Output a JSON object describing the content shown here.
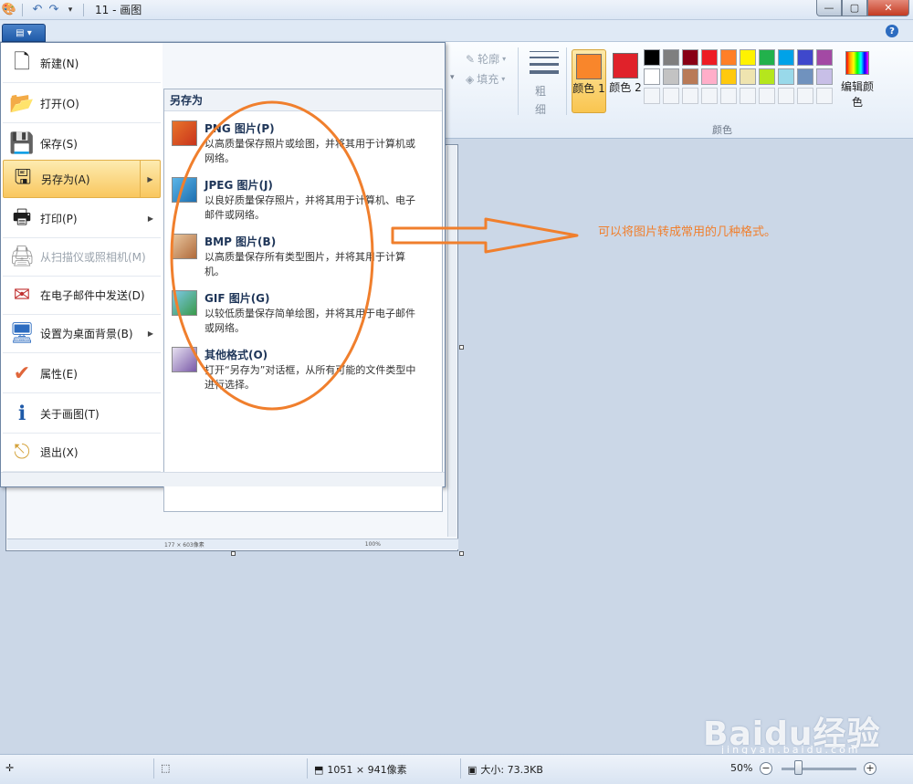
{
  "window": {
    "title": "11 - 画图",
    "controls": {
      "minimize": "—",
      "maximize": "▢",
      "close": "✕"
    }
  },
  "ribbon": {
    "help": "?",
    "outline_label": "轮廓",
    "fill_label": "填充",
    "thickness_label": "粗细",
    "color1_label": "颜色 1",
    "color2_label": "颜色 2",
    "edit_colors_label": "编辑颜色",
    "colors_group_label": "颜色",
    "color1": "#f9862b",
    "color2": "#e0222a",
    "palette": [
      "#000000",
      "#7f7f7f",
      "#880015",
      "#ed1c24",
      "#ff7f27",
      "#fff200",
      "#22b14c",
      "#00a2e8",
      "#3f48cc",
      "#a349a4",
      "#ffffff",
      "#c3c3c3",
      "#b97a57",
      "#ffaec9",
      "#ffc90e",
      "#efe4b0",
      "#b5e61d",
      "#99d9ea",
      "#7092be",
      "#c8bfe7"
    ]
  },
  "menu": {
    "items": [
      {
        "label": "新建(N)",
        "icon": "new-file-icon",
        "disabled": false,
        "submenu": false
      },
      {
        "label": "打开(O)",
        "icon": "open-folder-icon",
        "disabled": false,
        "submenu": false
      },
      {
        "label": "保存(S)",
        "icon": "save-disk-icon",
        "disabled": false,
        "submenu": false
      },
      {
        "label": "另存为(A)",
        "icon": "save-as-icon",
        "disabled": false,
        "submenu": true,
        "active": true
      },
      {
        "label": "打印(P)",
        "icon": "printer-icon",
        "disabled": false,
        "submenu": true
      },
      {
        "label": "从扫描仪或照相机(M)",
        "icon": "scanner-icon",
        "disabled": true,
        "submenu": false
      },
      {
        "label": "在电子邮件中发送(D)",
        "icon": "email-icon",
        "disabled": false,
        "submenu": false
      },
      {
        "label": "设置为桌面背景(B)",
        "icon": "desktop-background-icon",
        "disabled": false,
        "submenu": true
      },
      {
        "label": "属性(E)",
        "icon": "checkmark-icon",
        "disabled": false,
        "submenu": false
      },
      {
        "label": "关于画图(T)",
        "icon": "info-icon",
        "disabled": false,
        "submenu": false
      },
      {
        "label": "退出(X)",
        "icon": "exit-icon",
        "disabled": false,
        "submenu": false
      }
    ]
  },
  "save_as": {
    "header": "另存为",
    "items": [
      {
        "name": "PNG 图片(P)",
        "desc": "以高质量保存照片或绘图，并将其用于计算机或网络。",
        "icon": "png-image-icon"
      },
      {
        "name": "JPEG 图片(J)",
        "desc": "以良好质量保存照片，并将其用于计算机、电子邮件或网络。",
        "icon": "jpeg-image-icon"
      },
      {
        "name": "BMP 图片(B)",
        "desc": "以高质量保存所有类型图片，并将其用于计算机。",
        "icon": "bmp-image-icon"
      },
      {
        "name": "GIF 图片(G)",
        "desc": "以较低质量保存简单绘图，并将其用于电子邮件或网络。",
        "icon": "gif-image-icon"
      },
      {
        "name": "其他格式(O)",
        "desc": "打开“另存为”对话框，从所有可能的文件类型中进行选择。",
        "icon": "other-formats-icon"
      }
    ]
  },
  "annotation": {
    "text": "可以将图片转成常用的几种格式。",
    "color": "#f07f2d"
  },
  "inner_screenshot": {
    "size": "177 × 603像素",
    "zoom": "100%"
  },
  "statusbar": {
    "image_size": "1051 × 941像素",
    "file_size": "大小: 73.3KB",
    "zoom": "50%",
    "zoom_out": "−",
    "zoom_in": "+"
  },
  "watermark": {
    "text": "Baidu经验",
    "url": "jingyan.baidu.com"
  }
}
